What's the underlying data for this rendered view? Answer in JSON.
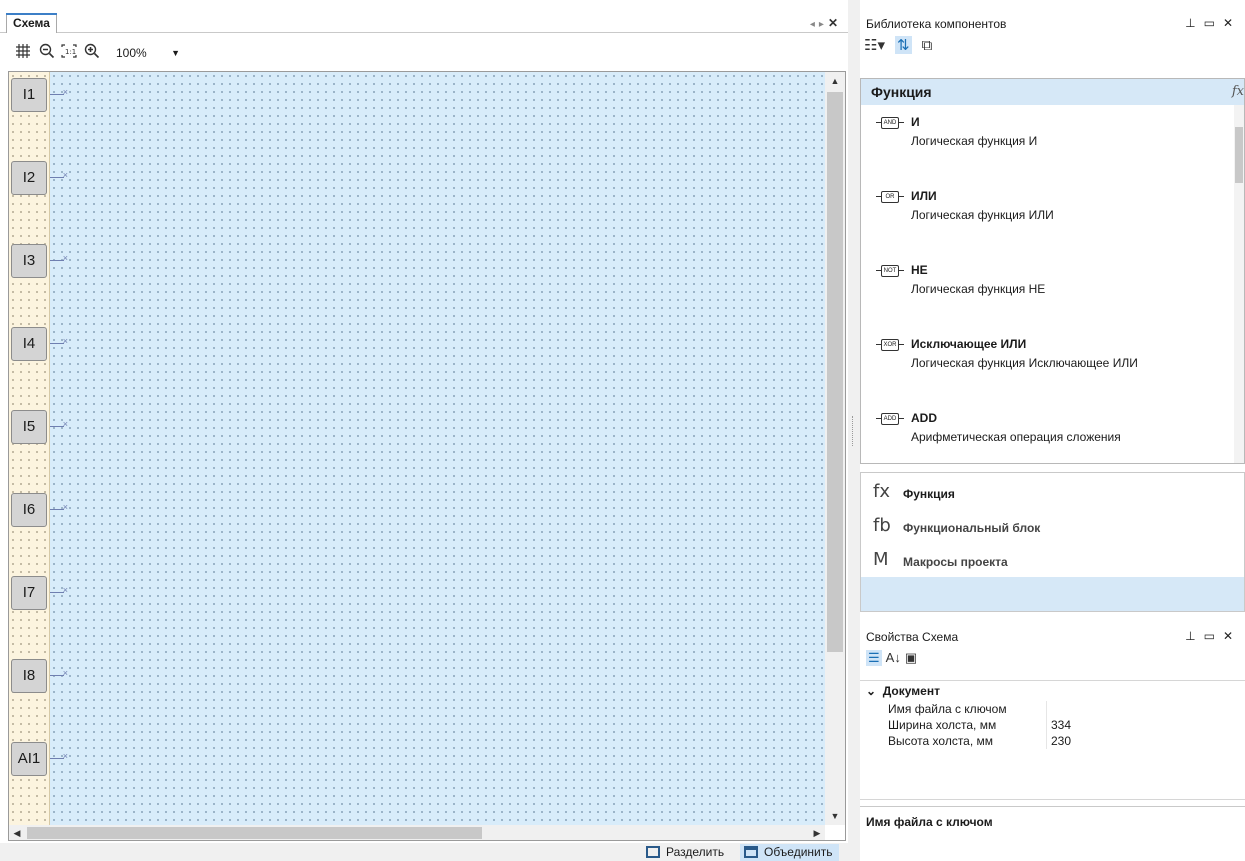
{
  "editor": {
    "tab_label": "Схема",
    "zoom": "100%",
    "pins": [
      "I1",
      "I2",
      "I3",
      "I4",
      "I5",
      "I6",
      "I7",
      "I8",
      "AI1"
    ],
    "split_label": "Разделить",
    "merge_label": "Объединить"
  },
  "library": {
    "title": "Библиотека компонентов",
    "list_header": "Функция",
    "items": [
      {
        "name": "И",
        "desc": "Логическая функция И",
        "icon": "AND"
      },
      {
        "name": "ИЛИ",
        "desc": "Логическая функция ИЛИ",
        "icon": "OR"
      },
      {
        "name": "НЕ",
        "desc": "Логическая функция НЕ",
        "icon": "NOT"
      },
      {
        "name": "Исключающее ИЛИ",
        "desc": "Логическая функция Исключающее ИЛИ",
        "icon": "XOR"
      },
      {
        "name": "ADD",
        "desc": "Арифметическая операция сложения",
        "icon": "ADD"
      }
    ],
    "categories": [
      {
        "glyph": "fx",
        "label": "Функция"
      },
      {
        "glyph": "fb",
        "label": "Функциональный блок"
      },
      {
        "glyph": "M",
        "label": "Макросы проекта"
      }
    ]
  },
  "properties": {
    "title": "Свойства Схема",
    "category": "Документ",
    "rows": [
      {
        "key": "Имя файла с ключом",
        "value": ""
      },
      {
        "key": "Ширина холста, мм",
        "value": "334"
      },
      {
        "key": "Высота холста, мм",
        "value": "230"
      }
    ],
    "description_title": "Имя файла с ключом"
  }
}
